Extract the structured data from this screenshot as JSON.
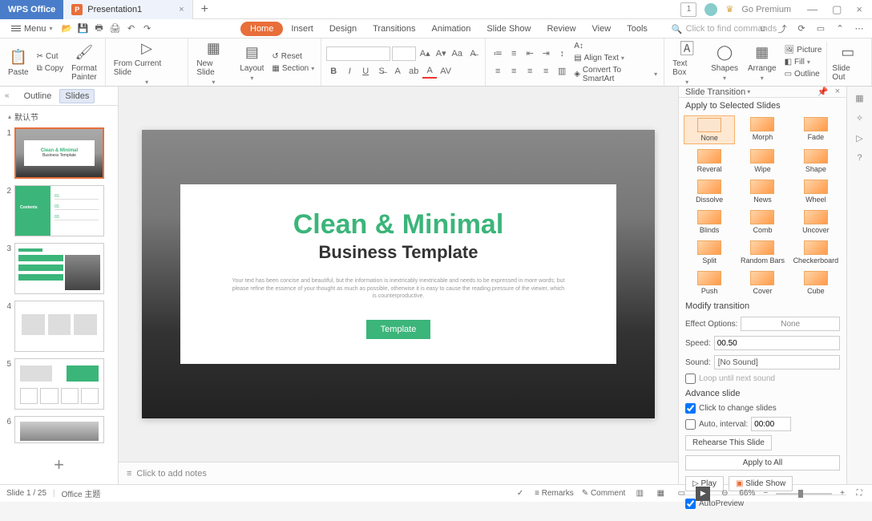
{
  "title": {
    "app": "WPS Office",
    "doc": "Presentation1",
    "premium": "Go Premium"
  },
  "menu_label": "Menu",
  "ribbon_tabs": [
    "Home",
    "Insert",
    "Design",
    "Transitions",
    "Animation",
    "Slide Show",
    "Review",
    "View",
    "Tools"
  ],
  "search_placeholder": "Click to find commands",
  "ribbon": {
    "paste": "Paste",
    "cut": "Cut",
    "copy": "Copy",
    "format_painter": "Format\nPainter",
    "from_current": "From Current Slide",
    "new_slide": "New Slide",
    "layout": "Layout",
    "reset": "Reset",
    "section": "Section",
    "align_text": "Align Text",
    "convert_smartart": "Convert To SmartArt",
    "text_box": "Text Box",
    "shapes": "Shapes",
    "arrange": "Arrange",
    "picture": "Picture",
    "fill": "Fill",
    "outline": "Outline",
    "slide_out": "Slide Out"
  },
  "left_panel": {
    "outline": "Outline",
    "slides": "Slides",
    "section": "默认节"
  },
  "slide_numbers": [
    "1",
    "2",
    "3",
    "4",
    "5",
    "6"
  ],
  "slide": {
    "title": "Clean & Minimal",
    "subtitle": "Business Template",
    "desc": "Your text has been concise and beautiful, but the information is inextricably inextricable and needs to be expressed in more words; but please refine the essence of your thought as much as possible, otherwise it is easy to cause the reading pressure of the viewer, which is counterproductive.",
    "button": "Template"
  },
  "notes": "Click to add notes",
  "transitions_panel": {
    "header": "Slide Transition",
    "apply_title": "Apply to Selected Slides",
    "items": [
      "None",
      "Morph",
      "Fade",
      "Reveral",
      "Wipe",
      "Shape",
      "Dissolve",
      "News",
      "Wheel",
      "Blinds",
      "Comb",
      "Uncover",
      "Split",
      "Random Bars",
      "Checkerboard",
      "Push",
      "Cover",
      "Cube"
    ],
    "modify": "Modify transition",
    "effect_options_label": "Effect Options:",
    "effect_options_value": "None",
    "speed_label": "Speed:",
    "speed_value": "00.50",
    "sound_label": "Sound:",
    "sound_value": "[No Sound]",
    "loop": "Loop until next sound",
    "advance": "Advance slide",
    "click_change": "Click to change slides",
    "auto": "Auto, interval:",
    "auto_value": "00:00",
    "rehearse": "Rehearse This Slide",
    "apply_all": "Apply to All",
    "play": "Play",
    "slide_show": "Slide Show",
    "autopreview": "AutoPreview"
  },
  "status": {
    "slide": "Slide 1 / 25",
    "theme": "Office 主题",
    "remarks": "Remarks",
    "comment": "Comment",
    "zoom": "66%"
  }
}
